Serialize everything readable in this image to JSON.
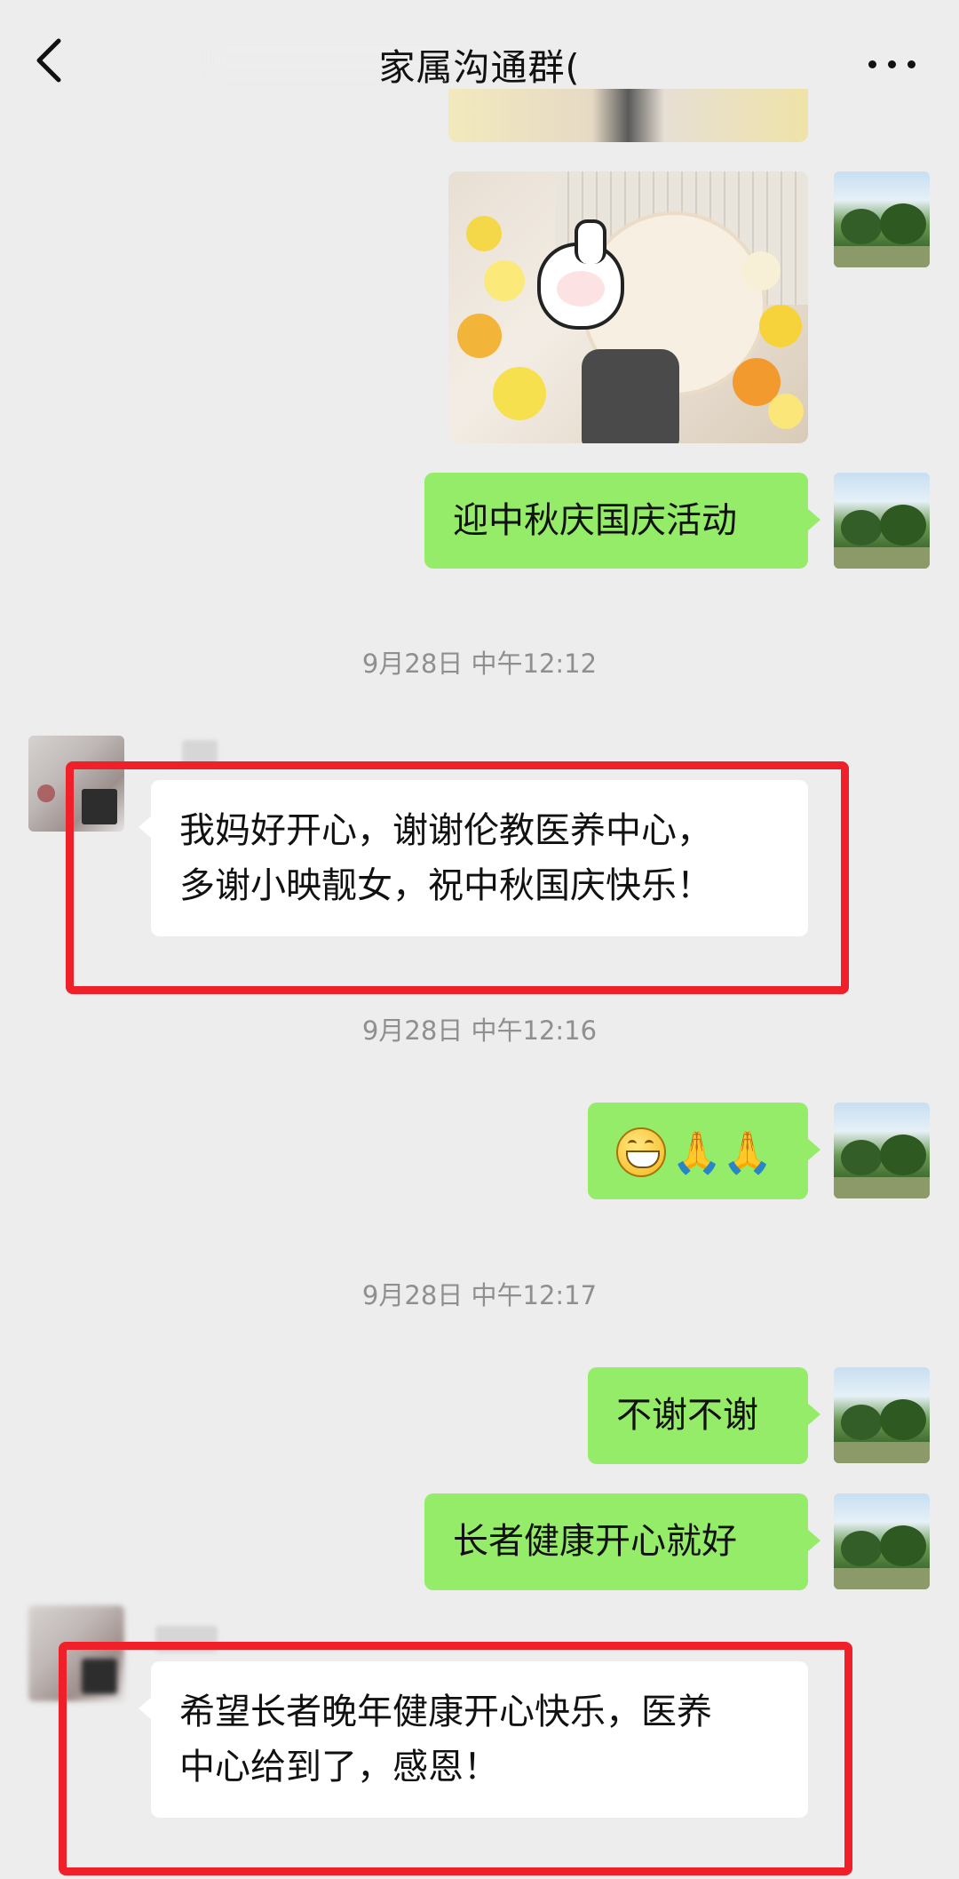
{
  "header": {
    "title": "家属沟通群(",
    "back_icon": "chevron-left-icon",
    "more_icon": "more-dots-icon"
  },
  "messages": {
    "m1_text": "迎中秋庆国庆活动",
    "t1": "9月28日 中午12:12",
    "m2_line1": "我妈好开心，谢谢伦教医养中心，",
    "m2_line2": "多谢小映靓女，祝中秋国庆快乐！",
    "t2": "9月28日 中午12:16",
    "m3_emoji": "🙏🙏",
    "t3": "9月28日 中午12:17",
    "m4_text": "不谢不谢",
    "m5_text": "长者健康开心就好",
    "m6_line1": "希望长者晚年健康开心快乐，医养",
    "m6_line2": "中心给到了，感恩！"
  },
  "colors": {
    "background": "#ededed",
    "my_bubble": "#95ec69",
    "their_bubble": "#ffffff",
    "highlight_box": "#f0202b",
    "timestamp": "#8f8f8f"
  }
}
